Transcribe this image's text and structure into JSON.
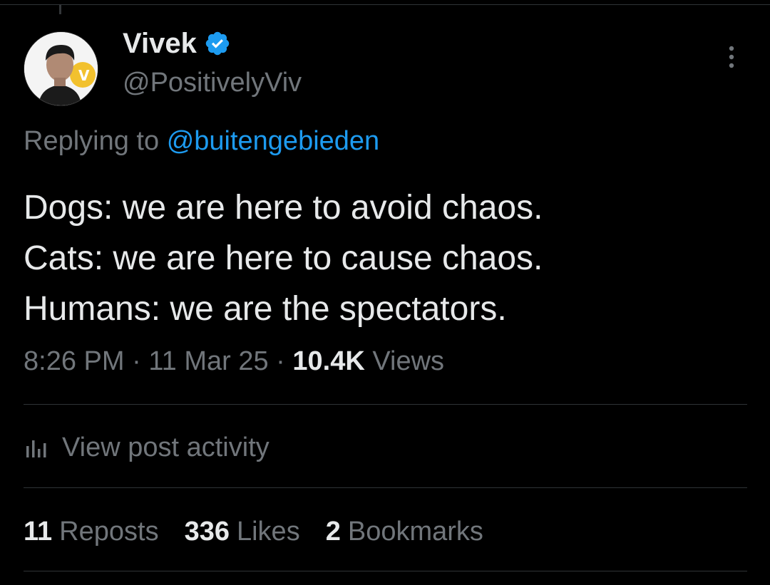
{
  "author": {
    "display_name": "Vivek",
    "handle": "@PositivelyViv",
    "verified": true,
    "verified_color": "#1d9bf0"
  },
  "reply": {
    "prefix": "Replying to",
    "mention": "@buitengebieden"
  },
  "tweet": {
    "lines": [
      "Dogs: we are here to avoid chaos.",
      "Cats: we are here to cause chaos.",
      "Humans: we are the spectators."
    ]
  },
  "meta": {
    "time": "8:26 PM",
    "separator": "·",
    "date": "11 Mar 25",
    "views_count": "10.4K",
    "views_label": "Views"
  },
  "activity": {
    "label": "View post activity",
    "icon": "bar-chart-icon"
  },
  "stats": {
    "reposts_count": "11",
    "reposts_label": "Reposts",
    "likes_count": "336",
    "likes_label": "Likes",
    "bookmarks_count": "2",
    "bookmarks_label": "Bookmarks"
  },
  "icons": {
    "more": "more-options-icon",
    "verified": "verified-badge-icon",
    "avatar": "avatar"
  },
  "colors": {
    "background": "#000000",
    "primary_text": "#e7e9ea",
    "secondary_text": "#71767b",
    "link": "#1d9bf0",
    "divider": "#2f3336"
  }
}
